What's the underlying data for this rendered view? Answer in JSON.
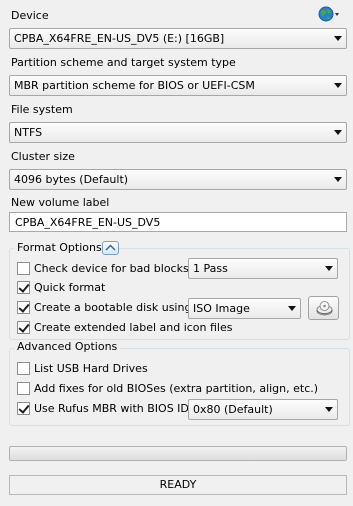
{
  "device": {
    "label": "Device",
    "value": "CPBA_X64FRE_EN-US_DV5 (E:) [16GB]"
  },
  "partition": {
    "label": "Partition scheme and target system type",
    "value": "MBR partition scheme for BIOS or UEFI-CSM"
  },
  "filesystem": {
    "label": "File system",
    "value": "NTFS"
  },
  "cluster": {
    "label": "Cluster size",
    "value": "4096 bytes (Default)"
  },
  "volume": {
    "label": "New volume label",
    "value": "CPBA_X64FRE_EN-US_DV5"
  },
  "format_options": {
    "title": "Format Options",
    "bad_blocks": {
      "label": "Check device for bad blocks",
      "checked": false,
      "passes": "1 Pass"
    },
    "quick_format": {
      "label": "Quick format",
      "checked": true
    },
    "bootable": {
      "label": "Create a bootable disk using",
      "checked": true,
      "source": "ISO Image"
    },
    "extended_label": {
      "label": "Create extended label and icon files",
      "checked": true
    }
  },
  "advanced_options": {
    "title": "Advanced Options",
    "list_usb": {
      "label": "List USB Hard Drives",
      "checked": false
    },
    "old_bios": {
      "label": "Add fixes for old BIOSes (extra partition, align, etc.)",
      "checked": false
    },
    "rufus_mbr": {
      "label": "Use Rufus MBR with BIOS ID",
      "checked": true,
      "bios_id": "0x80 (Default)"
    }
  },
  "progress": {
    "value": 0
  },
  "status": {
    "text": "READY"
  },
  "icons": {
    "globe": "globe-icon",
    "collapse": "collapse-arrow-icon",
    "disk": "disk-drive-icon"
  }
}
